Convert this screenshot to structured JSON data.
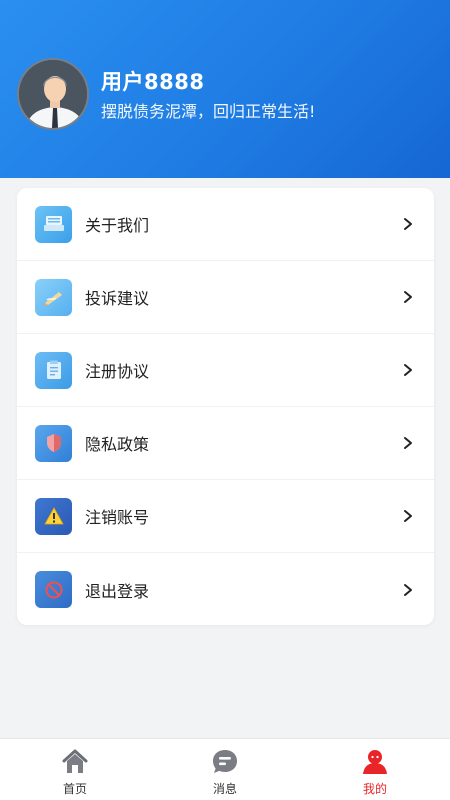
{
  "profile": {
    "username": "用户8888",
    "slogan": "摆脱债务泥潭，回归正常生活!"
  },
  "menu": [
    {
      "label": "关于我们",
      "icon": "about-us-icon"
    },
    {
      "label": "投诉建议",
      "icon": "feedback-icon"
    },
    {
      "label": "注册协议",
      "icon": "agreement-icon"
    },
    {
      "label": "隐私政策",
      "icon": "privacy-shield-icon"
    },
    {
      "label": "注销账号",
      "icon": "warning-icon"
    },
    {
      "label": "退出登录",
      "icon": "logout-icon"
    }
  ],
  "tabbar": [
    {
      "label": "首页",
      "icon": "home-icon",
      "active": false
    },
    {
      "label": "消息",
      "icon": "message-icon",
      "active": false
    },
    {
      "label": "我的",
      "icon": "user-icon",
      "active": true
    }
  ],
  "colors": {
    "header_gradient_start": "#2a8ff0",
    "header_gradient_end": "#1667d3",
    "active_tab": "#e8262a"
  }
}
